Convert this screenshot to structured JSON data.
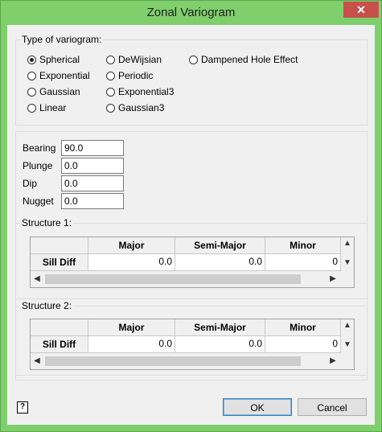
{
  "window": {
    "title": "Zonal Variogram",
    "close_glyph": "✕"
  },
  "variogram_group": {
    "label": "Type of variogram:",
    "options": [
      {
        "label": "Spherical",
        "selected": true
      },
      {
        "label": "Exponential",
        "selected": false
      },
      {
        "label": "Gaussian",
        "selected": false
      },
      {
        "label": "Linear",
        "selected": false
      },
      {
        "label": "DeWijsian",
        "selected": false
      },
      {
        "label": "Periodic",
        "selected": false
      },
      {
        "label": "Exponential3",
        "selected": false
      },
      {
        "label": "Gaussian3",
        "selected": false
      },
      {
        "label": "Dampened Hole Effect",
        "selected": false
      }
    ]
  },
  "params": {
    "bearing_label": "Bearing",
    "bearing_value": "90.0",
    "plunge_label": "Plunge",
    "plunge_value": "0.0",
    "dip_label": "Dip",
    "dip_value": "0.0",
    "nugget_label": "Nugget",
    "nugget_value": "0.0"
  },
  "structure1": {
    "label": "Structure 1:",
    "columns": [
      "Major",
      "Semi-Major",
      "Minor"
    ],
    "row_label": "Sill Diff",
    "values": [
      "0.0",
      "0.0",
      "0"
    ]
  },
  "structure2": {
    "label": "Structure 2:",
    "columns": [
      "Major",
      "Semi-Major",
      "Minor"
    ],
    "row_label": "Sill Diff",
    "values": [
      "0.0",
      "0.0",
      "0"
    ]
  },
  "buttons": {
    "ok": "OK",
    "cancel": "Cancel",
    "help": "?"
  },
  "scroll": {
    "up": "▲",
    "down": "▼",
    "left": "◀",
    "right": "▶"
  }
}
